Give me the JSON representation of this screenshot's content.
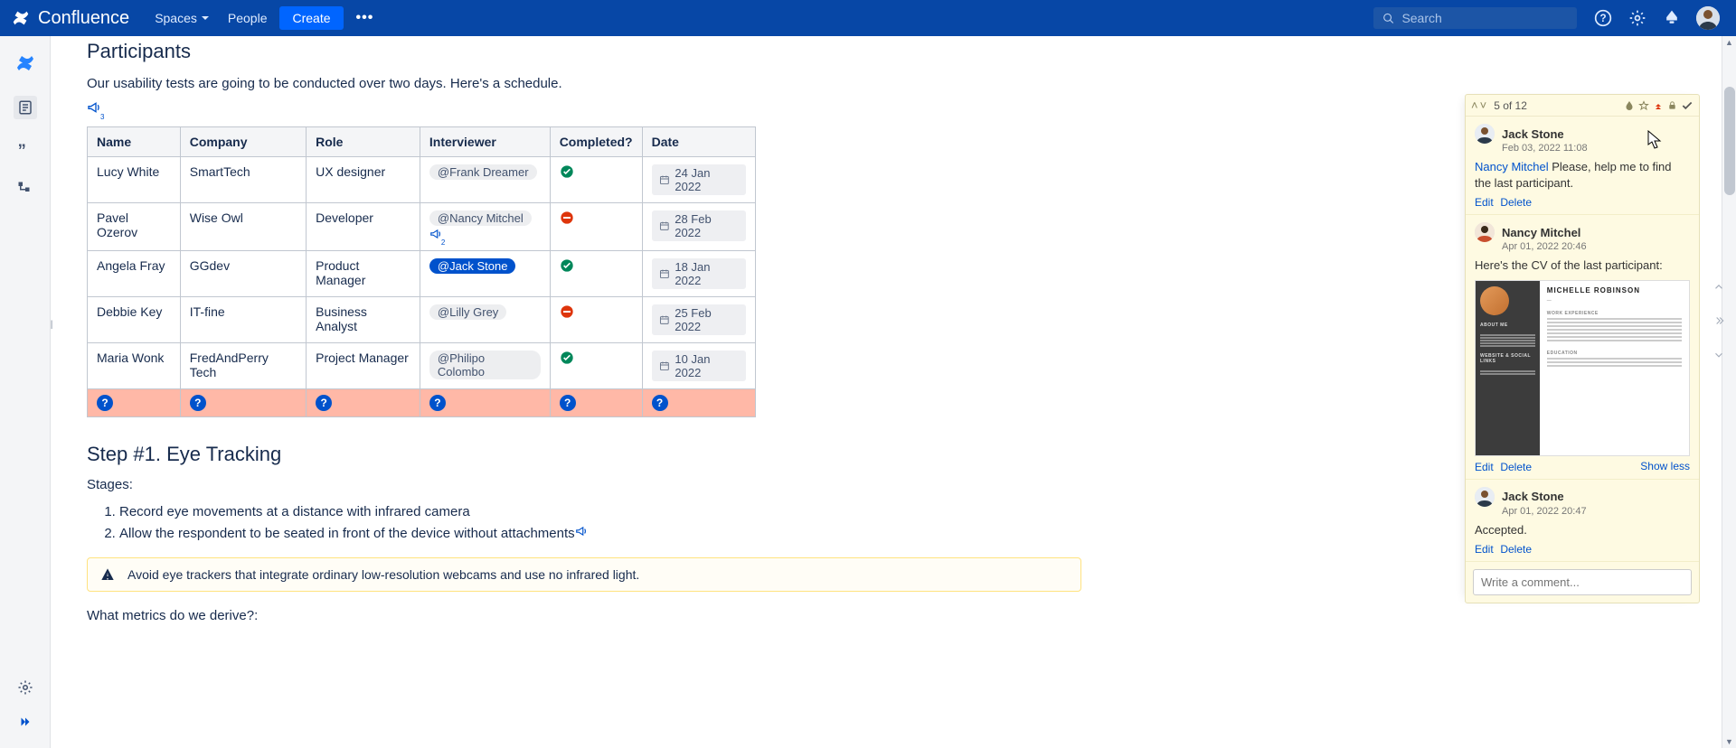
{
  "brand": "Confluence",
  "nav": {
    "spaces": "Spaces",
    "people": "People",
    "create": "Create"
  },
  "search": {
    "placeholder": "Search"
  },
  "headings": {
    "participants": "Participants",
    "intro": "Our usability tests are going to be conducted over two days. Here's a schedule.",
    "step1": "Step #1. Eye Tracking",
    "stages_label": "Stages:",
    "metrics_q": "What metrics do we derive?:"
  },
  "mega_count_top": "3",
  "mega_count_row2": "2",
  "table": {
    "headers": {
      "name": "Name",
      "company": "Company",
      "role": "Role",
      "interviewer": "Interviewer",
      "completed": "Completed?",
      "date": "Date"
    },
    "rows": [
      {
        "name": "Lucy White",
        "company": "SmartTech",
        "role": "UX designer",
        "interviewer": "@Frank Dreamer",
        "completed": "ok",
        "date": "24 Jan 2022"
      },
      {
        "name": "Pavel Ozerov",
        "company": "Wise Owl",
        "role": "Developer",
        "interviewer": "@Nancy Mitchel",
        "completed": "no",
        "date": "28 Feb 2022"
      },
      {
        "name": "Angela Fray",
        "company": "GGdev",
        "role": "Product Manager",
        "interviewer": "@Jack Stone",
        "completed": "ok",
        "date": "18 Jan 2022"
      },
      {
        "name": "Debbie Key",
        "company": "IT-fine",
        "role": "Business Analyst",
        "interviewer": "@Lilly Grey",
        "completed": "no",
        "date": "25 Feb 2022"
      },
      {
        "name": "Maria Wonk",
        "company": "FredAndPerry Tech",
        "role": "Project Manager",
        "interviewer": "@Philipo Colombo",
        "completed": "ok",
        "date": "10 Jan 2022"
      }
    ]
  },
  "stages": [
    "Record eye movements at a distance with infrared camera",
    "Allow the respondent to be seated in front of the device without attachments"
  ],
  "warning": "Avoid eye trackers that integrate ordinary low-resolution webcams and use no infrared light.",
  "comments": {
    "counter": "5 of 12",
    "c1": {
      "author": "Jack Stone",
      "date": "Feb 03, 2022 11:08",
      "mention": "Nancy Mitchel",
      "body": " Please, help me to find the last participant.",
      "edit": "Edit",
      "delete": "Delete"
    },
    "c2": {
      "author": "Nancy Mitchel",
      "date": "Apr 01, 2022 20:46",
      "body": "Here's the CV of the last participant:",
      "edit": "Edit",
      "delete": "Delete",
      "show_less": "Show less",
      "cv_name": "MICHELLE ROBINSON",
      "cv_about": "ABOUT ME",
      "cv_links": "WEBSITE & SOCIAL LINKS",
      "cv_exp": "WORK EXPERIENCE",
      "cv_edu": "EDUCATION"
    },
    "c3": {
      "author": "Jack Stone",
      "date": "Apr 01, 2022 20:47",
      "body": "Accepted.",
      "edit": "Edit",
      "delete": "Delete"
    },
    "input_placeholder": "Write a comment..."
  }
}
